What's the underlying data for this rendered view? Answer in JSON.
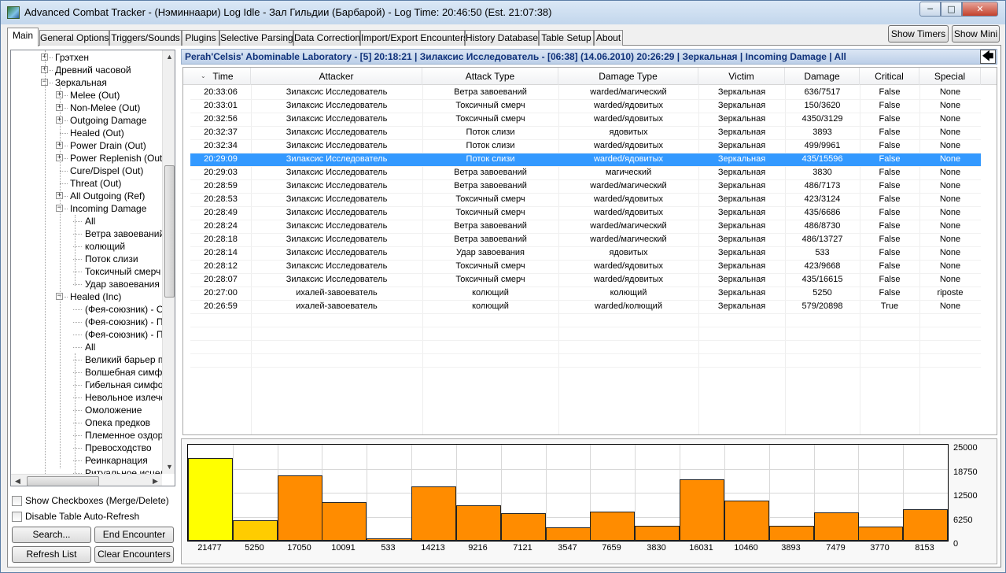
{
  "window": {
    "title": "Advanced Combat Tracker - (Нэминнаари) Log Idle - Зал Гильдии (Барбарой) - Log Time: 20:46:50 (Est. 21:07:38)",
    "min_glyph": "─",
    "max_glyph": "□",
    "close_glyph": "✕"
  },
  "tabs": [
    "Main",
    "General Options",
    "Triggers/Sounds",
    "Plugins",
    "Selective Parsing",
    "Data Correction",
    "Import/Export Encounters",
    "History Database",
    "Table Setup",
    "About"
  ],
  "top_buttons": {
    "show_timers": "Show Timers",
    "show_mini": "Show Mini"
  },
  "tree": {
    "items": [
      {
        "label": "Грэтхен",
        "level": 1,
        "expander": "+"
      },
      {
        "label": "Древний часовой",
        "level": 1,
        "expander": "+"
      },
      {
        "label": "Зеркальная",
        "level": 1,
        "expander": "−"
      },
      {
        "label": "Melee (Out)",
        "level": 2,
        "expander": "+"
      },
      {
        "label": "Non-Melee (Out)",
        "level": 2,
        "expander": "+"
      },
      {
        "label": "Outgoing Damage",
        "level": 2,
        "expander": "+"
      },
      {
        "label": "Healed (Out)",
        "level": 2,
        "expander": ""
      },
      {
        "label": "Power Drain (Out)",
        "level": 2,
        "expander": "+"
      },
      {
        "label": "Power Replenish (Out)",
        "level": 2,
        "expander": "+"
      },
      {
        "label": "Cure/Dispel (Out)",
        "level": 2,
        "expander": ""
      },
      {
        "label": "Threat (Out)",
        "level": 2,
        "expander": ""
      },
      {
        "label": "All Outgoing (Ref)",
        "level": 2,
        "expander": "+"
      },
      {
        "label": "Incoming Damage",
        "level": 2,
        "expander": "−"
      },
      {
        "label": "All",
        "level": 3,
        "expander": ""
      },
      {
        "label": "Ветра завоеваний",
        "level": 3,
        "expander": ""
      },
      {
        "label": "колющий",
        "level": 3,
        "expander": ""
      },
      {
        "label": "Поток слизи",
        "level": 3,
        "expander": ""
      },
      {
        "label": "Токсичный смерч",
        "level": 3,
        "expander": ""
      },
      {
        "label": "Удар завоевания",
        "level": 3,
        "expander": ""
      },
      {
        "label": "Healed (Inc)",
        "level": 2,
        "expander": "−"
      },
      {
        "label": "(Фея-союзник) - Оз",
        "level": 3,
        "expander": ""
      },
      {
        "label": "(Фея-союзник) - По",
        "level": 3,
        "expander": ""
      },
      {
        "label": "(Фея-союзник) - По",
        "level": 3,
        "expander": ""
      },
      {
        "label": "All",
        "level": 3,
        "expander": ""
      },
      {
        "label": "Великий барьер пре",
        "level": 3,
        "expander": ""
      },
      {
        "label": "Волшебная симфон",
        "level": 3,
        "expander": ""
      },
      {
        "label": "Гибельная симфони",
        "level": 3,
        "expander": ""
      },
      {
        "label": "Невольное излечен",
        "level": 3,
        "expander": ""
      },
      {
        "label": "Омоложение",
        "level": 3,
        "expander": ""
      },
      {
        "label": "Опека предков",
        "level": 3,
        "expander": ""
      },
      {
        "label": "Племенное оздорo",
        "level": 3,
        "expander": ""
      },
      {
        "label": "Превосходство",
        "level": 3,
        "expander": ""
      },
      {
        "label": "Реинкарнация",
        "level": 3,
        "expander": ""
      },
      {
        "label": "Ритуальное исцеле",
        "level": 3,
        "expander": ""
      }
    ]
  },
  "options": {
    "show_checkboxes": "Show Checkboxes (Merge/Delete)",
    "disable_autorefresh": "Disable Table Auto-Refresh"
  },
  "buttons": {
    "search": "Search...",
    "end_encounter": "End Encounter",
    "refresh_list": "Refresh List",
    "clear_encounters": "Clear Encounters"
  },
  "encounter": {
    "header": "Perah'Celsis' Abominable Laboratory - [5] 20:18:21 | Зилаксис Исследователь - [06:38] (14.06.2010) 20:26:29 | Зеркальная | Incoming Damage | All",
    "back_glyph": "🡄"
  },
  "table": {
    "sort_glyph": "⌄",
    "columns": [
      "Time",
      "Attacker",
      "Attack Type",
      "Damage Type",
      "Victim",
      "Damage",
      "Critical",
      "Special"
    ],
    "selected_row": 5,
    "rows": [
      [
        "20:33:06",
        "Зилаксис Исследователь",
        "Ветра завоеваний",
        "warded/магический",
        "Зеркальная",
        "636/7517",
        "False",
        "None"
      ],
      [
        "20:33:01",
        "Зилаксис Исследователь",
        "Токсичный смерч",
        "warded/ядовитых",
        "Зеркальная",
        "150/3620",
        "False",
        "None"
      ],
      [
        "20:32:56",
        "Зилаксис Исследователь",
        "Токсичный смерч",
        "warded/ядовитых",
        "Зеркальная",
        "4350/3129",
        "False",
        "None"
      ],
      [
        "20:32:37",
        "Зилаксис Исследователь",
        "Поток слизи",
        "ядовитых",
        "Зеркальная",
        "3893",
        "False",
        "None"
      ],
      [
        "20:32:34",
        "Зилаксис Исследователь",
        "Поток слизи",
        "warded/ядовитых",
        "Зеркальная",
        "499/9961",
        "False",
        "None"
      ],
      [
        "20:29:09",
        "Зилаксис Исследователь",
        "Поток слизи",
        "warded/ядовитых",
        "Зеркальная",
        "435/15596",
        "False",
        "None"
      ],
      [
        "20:29:03",
        "Зилаксис Исследователь",
        "Ветра завоеваний",
        "магический",
        "Зеркальная",
        "3830",
        "False",
        "None"
      ],
      [
        "20:28:59",
        "Зилаксис Исследователь",
        "Ветра завоеваний",
        "warded/магический",
        "Зеркальная",
        "486/7173",
        "False",
        "None"
      ],
      [
        "20:28:53",
        "Зилаксис Исследователь",
        "Токсичный смерч",
        "warded/ядовитых",
        "Зеркальная",
        "423/3124",
        "False",
        "None"
      ],
      [
        "20:28:49",
        "Зилаксис Исследователь",
        "Токсичный смерч",
        "warded/ядовитых",
        "Зеркальная",
        "435/6686",
        "False",
        "None"
      ],
      [
        "20:28:24",
        "Зилаксис Исследователь",
        "Ветра завоеваний",
        "warded/магический",
        "Зеркальная",
        "486/8730",
        "False",
        "None"
      ],
      [
        "20:28:18",
        "Зилаксис Исследователь",
        "Ветра завоеваний",
        "warded/магический",
        "Зеркальная",
        "486/13727",
        "False",
        "None"
      ],
      [
        "20:28:14",
        "Зилаксис Исследователь",
        "Удар завоевания",
        "ядовитых",
        "Зеркальная",
        "533",
        "False",
        "None"
      ],
      [
        "20:28:12",
        "Зилаксис Исследователь",
        "Токсичный смерч",
        "warded/ядовитых",
        "Зеркальная",
        "423/9668",
        "False",
        "None"
      ],
      [
        "20:28:07",
        "Зилаксис Исследователь",
        "Токсичный смерч",
        "warded/ядовитых",
        "Зеркальная",
        "435/16615",
        "False",
        "None"
      ],
      [
        "20:27:00",
        "ихалей-завоеватель",
        "колющий",
        "колющий",
        "Зеркальная",
        "5250",
        "False",
        "riposte"
      ],
      [
        "20:26:59",
        "ихалей-завоеватель",
        "колющий",
        "warded/колющий",
        "Зеркальная",
        "579/20898",
        "True",
        "None"
      ]
    ]
  },
  "chart_data": {
    "type": "bar",
    "categories": [
      "21477",
      "5250",
      "17050",
      "10091",
      "533",
      "14213",
      "9216",
      "7121",
      "3547",
      "7659",
      "3830",
      "16031",
      "10460",
      "3893",
      "7479",
      "3770",
      "8153"
    ],
    "values": [
      21477,
      5250,
      17050,
      10091,
      533,
      14213,
      9216,
      7121,
      3547,
      7659,
      3830,
      16031,
      10460,
      3893,
      7479,
      3770,
      8153
    ],
    "bar_colors": [
      "#ffff00",
      "#ffcc00",
      "#ff8c00",
      "#ff8c00",
      "#ff8c00",
      "#ff8c00",
      "#ff8c00",
      "#ff8c00",
      "#ff8c00",
      "#ff8c00",
      "#ff8c00",
      "#ff8c00",
      "#ff8c00",
      "#ff8c00",
      "#ff8c00",
      "#ff8c00",
      "#ff8c00"
    ],
    "ylim": [
      0,
      25000
    ],
    "yticks": [
      "25000",
      "18750",
      "12500",
      "6250",
      "0"
    ],
    "grid": true
  },
  "colors": {
    "selection": "#3399ff",
    "header_text": "#10327a",
    "bar_main": "#ff8c00"
  }
}
